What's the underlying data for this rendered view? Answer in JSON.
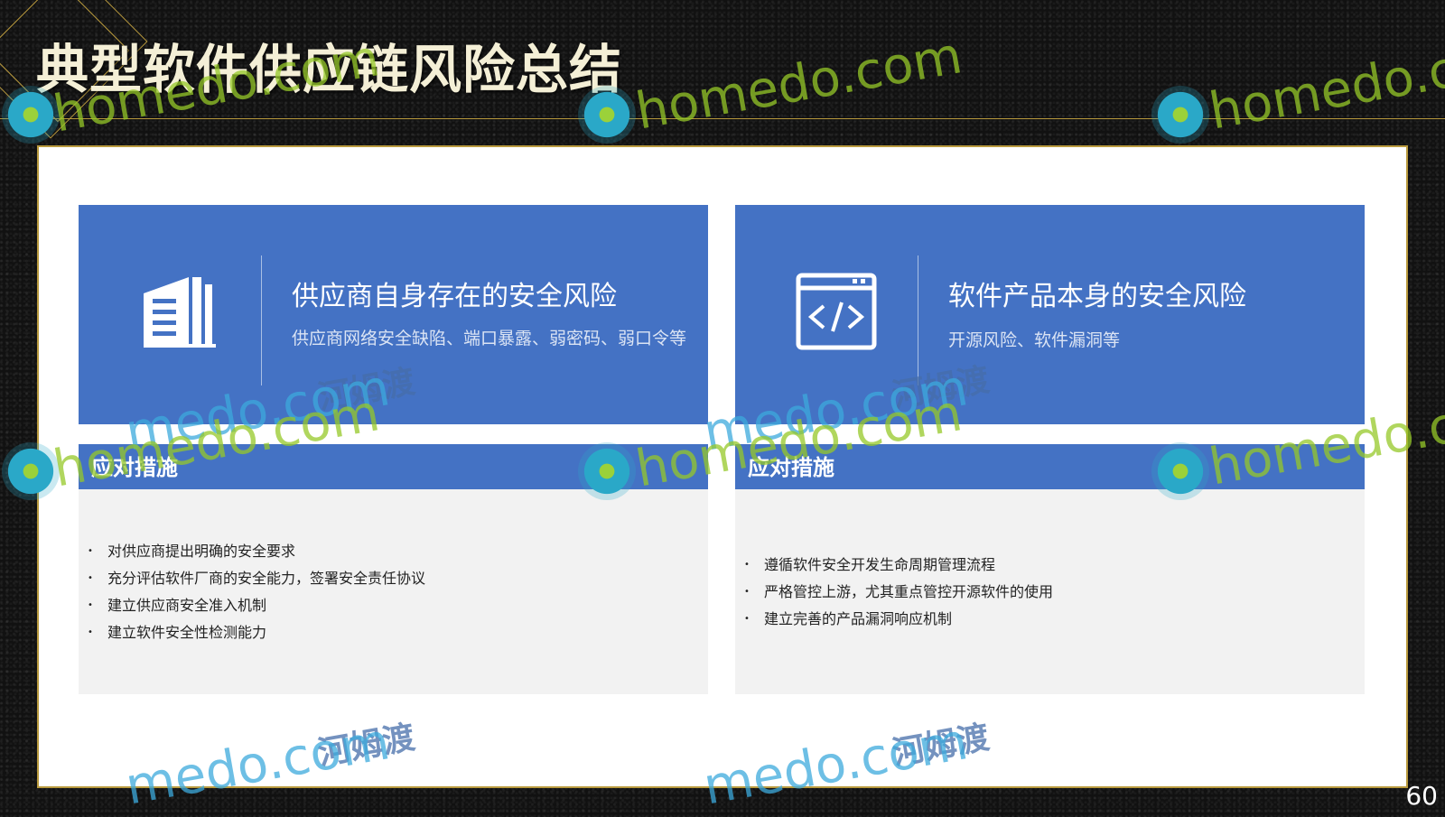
{
  "slide": {
    "title": "典型软件供应链风险总结",
    "page_number": "60"
  },
  "cards": [
    {
      "icon": "building-icon",
      "title": "供应商自身存在的安全风险",
      "description": "供应商网络安全缺陷、端口暴露、弱密码、弱口令等",
      "measures_label": "应对措施",
      "measures": [
        "对供应商提出明确的安全要求",
        "充分评估软件厂商的安全能力，签署安全责任协议",
        "建立供应商安全准入机制",
        "建立软件安全性检测能力"
      ]
    },
    {
      "icon": "code-window-icon",
      "title": "软件产品本身的安全风险",
      "description": "开源风险、软件漏洞等",
      "measures_label": "应对措施",
      "measures": [
        "遵循软件安全开发生命周期管理流程",
        "严格管控上游，尤其重点管控开源软件的使用",
        "建立完善的产品漏洞响应机制"
      ]
    }
  ],
  "watermarks": {
    "site": "homedo.com",
    "site_cut": "medo.com",
    "site_right_top": "homedo.co",
    "site_cn": "河姆渡"
  },
  "colors": {
    "accent_blue": "#4472c4",
    "gold_border": "#b99a3e",
    "panel_bg": "#ffffff",
    "measures_bg": "#f2f2f2"
  }
}
